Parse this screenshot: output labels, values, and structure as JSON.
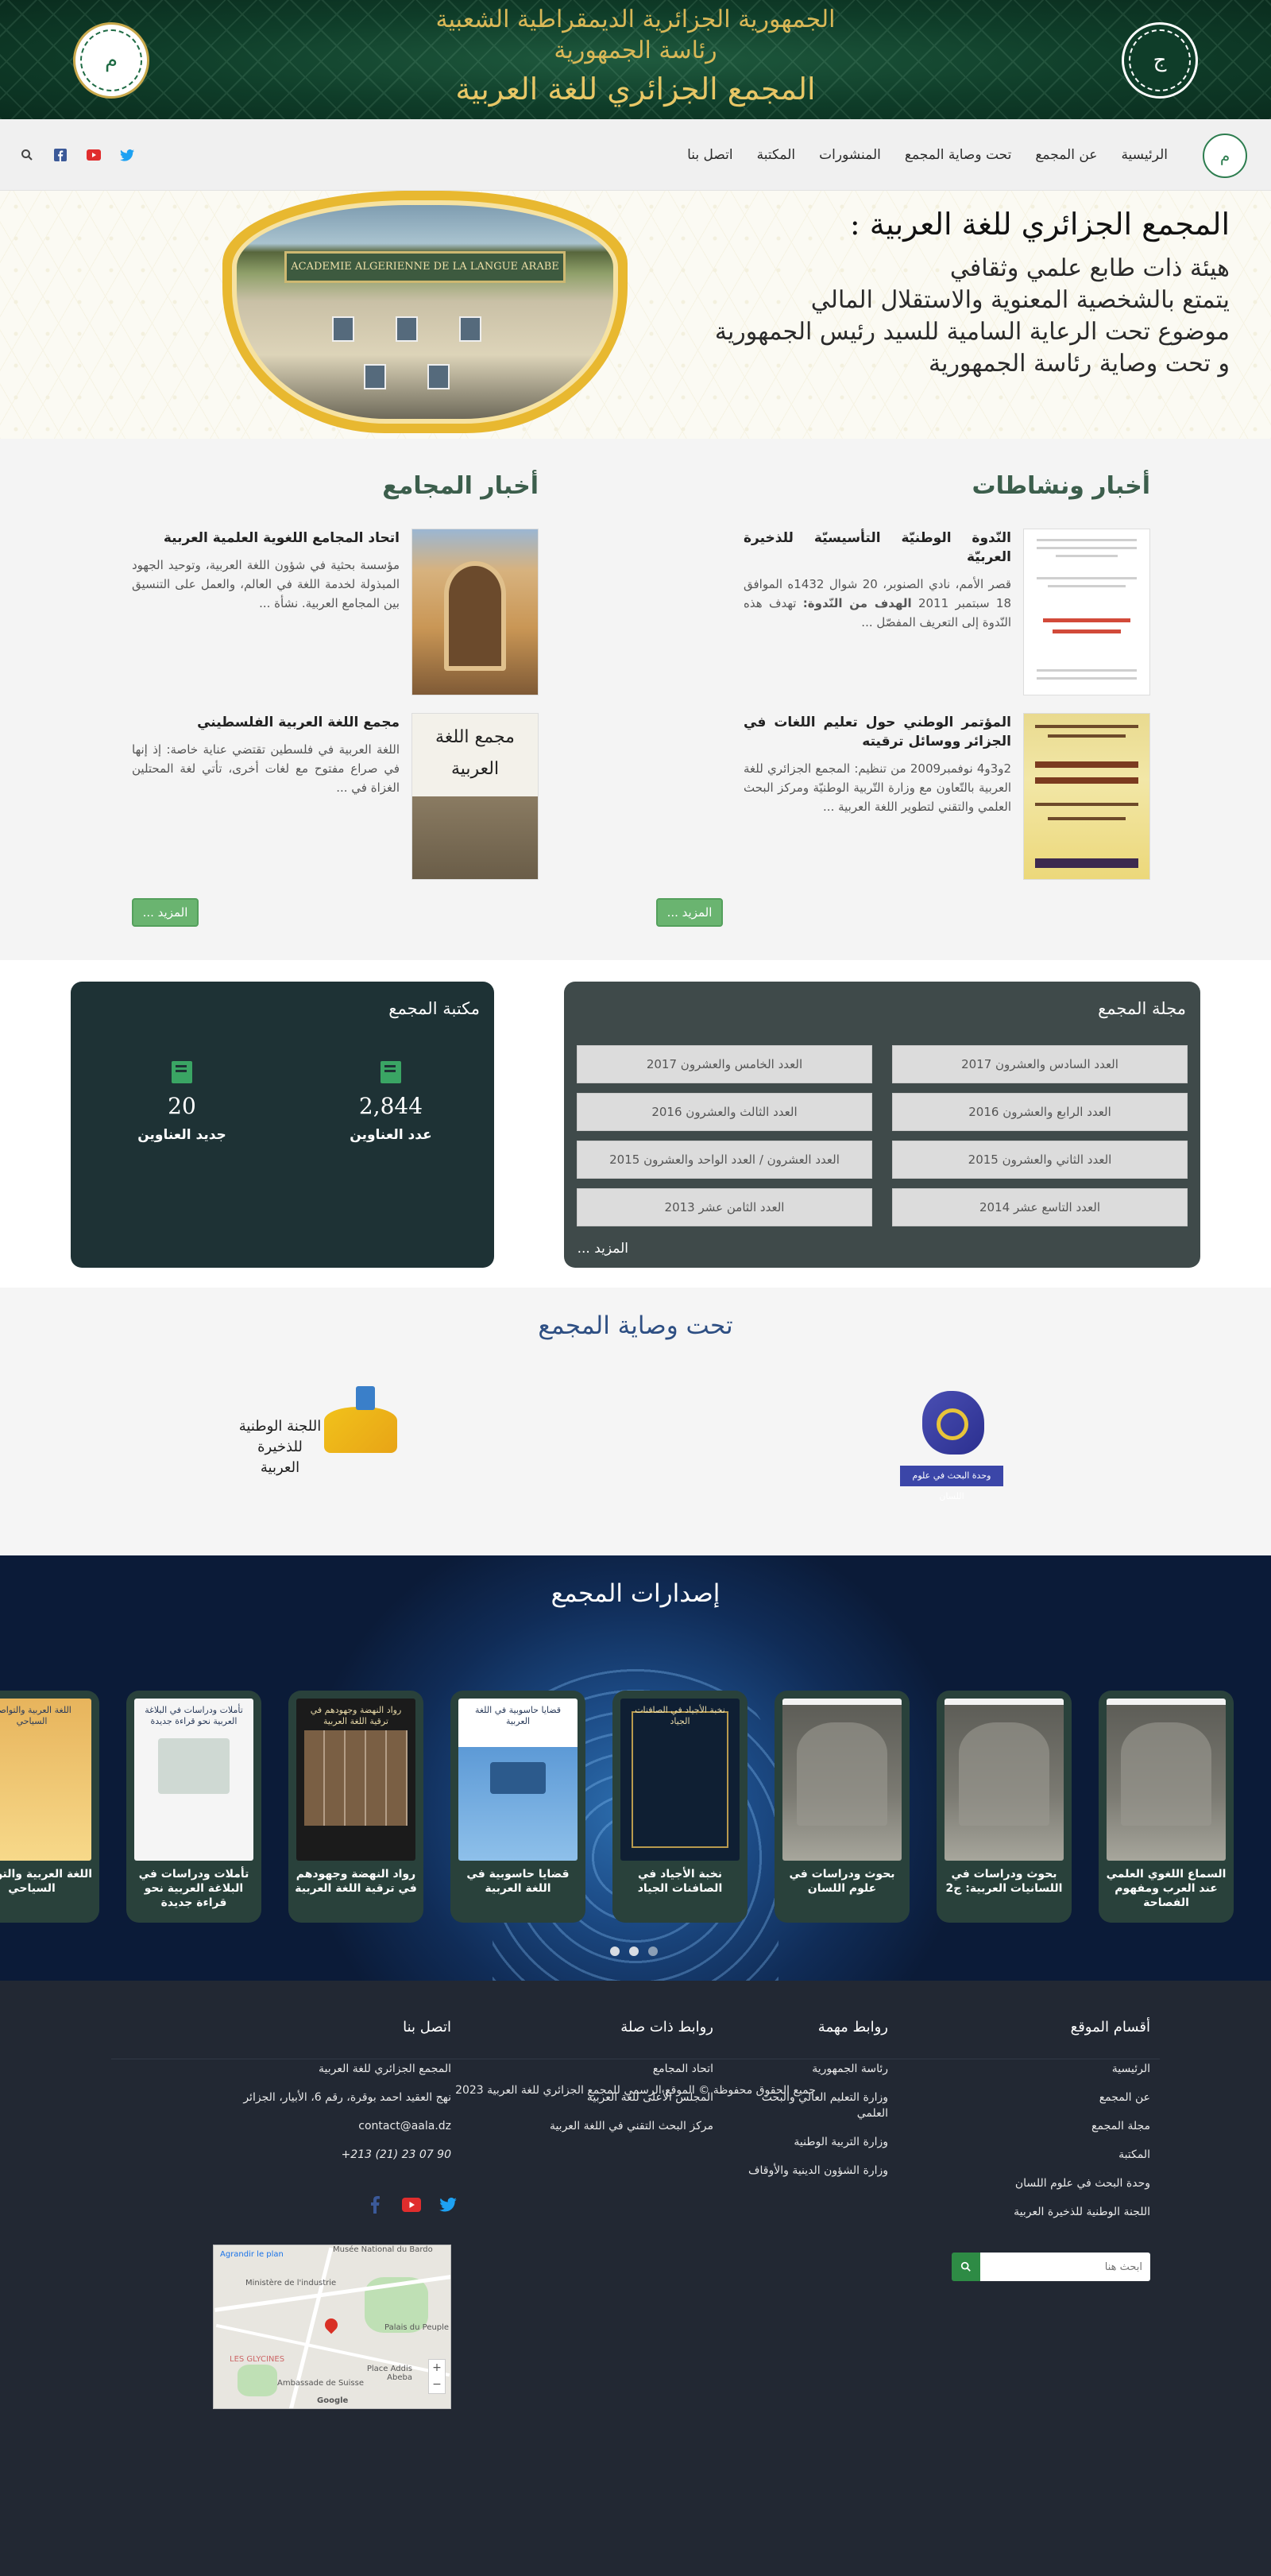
{
  "banner": {
    "line1": "الجمهورية الجزائرية الديمقراطية الشعبية",
    "line2": "رئاسة الجمهورية",
    "line3": "المجمع الجزائري للغة العربية"
  },
  "nav": {
    "items": [
      "الرئيسية",
      "عن المجمع",
      "تحت وصاية المجمع",
      "المنشورات",
      "المكتبة",
      "اتصل بنا"
    ]
  },
  "hero": {
    "title": "المجمع الجزائري للغة العربية :",
    "lines": [
      "هيئة ذات طابع علمي وثقافي",
      "يتمتع بالشخصية المعنوية والاستقلال المالي",
      "موضوع تحت الرعاية السامية للسيد رئيس الجمهورية",
      "و تحت وصاية رئاسة الجمهورية"
    ],
    "sign": "ACADEMIE ALGERIENNE DE LA LANGUE ARABE"
  },
  "news": {
    "activities_title": "أخبار ونشاطات",
    "academies_title": "أخبار المجامع",
    "activities": [
      {
        "title": "النّدوة الوطنيّة التأسيسيّة للذخيرة العربيّة",
        "text_plain": "قصر الأمم، نادي الصنوبر، 20 شوال 1432ه الموافق 18 سبتمبر 2011 ",
        "text_bold": "الهدف من النّدوة:",
        "text_rest": " تهدف هذه النّدوة إلى التعريف المفصّل ..."
      },
      {
        "title": "المؤتمر الوطني حول تعليم اللغات في الجزائر ووسائل ترقيته",
        "text_plain": "2و3و4 نوفمبر2009 من تنظيم: المجمع الجزائري للغة العربية بالتّعاون مع وزارة التّربية الوطنيّة ومركز البحث العلمي والتقني لتطوير اللغة العربية ..."
      }
    ],
    "academies": [
      {
        "title": "اتحاد المجامع اللغوية العلمية العربية",
        "text": "مؤسسة بحثية في شؤون اللغة العربية، وتوحيد الجهود المبذولة لخدمة اللغة في العالم، والعمل على التنسيق بين المجامع العربية. نشأة ..."
      },
      {
        "title": "مجمع اللغة العربية الفلسطيني",
        "text": " اللغة العربية في فلسطين تقتضي عناية خاصة: إذ إنها في صراع مفتوح مع لغات أخرى، تأتي لغة المحتلين الغزاة في ..."
      }
    ],
    "more_label": "المزيد ..."
  },
  "journal": {
    "title": "مجلة المجمع",
    "issues": [
      "العدد السادس والعشرون 2017",
      "العدد الخامس والعشرون 2017",
      "العدد الرابع والعشرون 2016",
      "العدد الثالث والعشرون 2016",
      "العدد الثاني والعشرون 2015",
      "العدد العشرون / العدد الواحد والعشرون 2015",
      "العدد التاسع عشر 2014",
      "العدد الثامن عشر 2013"
    ],
    "more_label": "المزيد ..."
  },
  "library": {
    "title": "مكتبة المجمع",
    "stats": [
      {
        "value": "2,844",
        "label": "عدد العناوين"
      },
      {
        "value": "20",
        "label": "جديد العناوين"
      }
    ]
  },
  "tutelage": {
    "title": "تحت وصاية المجمع",
    "logo_research": "وحدة البحث في علوم اللسان",
    "logo_committee": "اللجنة الوطنية للذخيرة العربية"
  },
  "publications": {
    "title": "إصدارات المجمع",
    "items": [
      {
        "title": "السماع اللغوي العلمي عند العرب ومفهوم الفصاحة",
        "cover": "stone"
      },
      {
        "title": "بحوث ودراسات في اللسانيات العربية: ج2",
        "cover": "stone"
      },
      {
        "title": "بحوث ودراسات في علوم اللسان",
        "cover": "stone"
      },
      {
        "title": "نخبة الأجياد في الصافنات الجياد",
        "cover": "dark",
        "cover_text": "نخبة الأجياد في الصافنات الجياد"
      },
      {
        "title": "قضايا حاسوبية في اللغة العربية",
        "cover": "blue",
        "cover_text": "قضايا حاسوبية في اللغة العربية"
      },
      {
        "title": "رواد النهضة وجهودهم في ترقية اللغة العربية",
        "cover": "faces",
        "cover_text": "رواد النهضة وجهودهم في ترقية اللغة العربية"
      },
      {
        "title": "تأملات ودراسات في البلاغة العربية نحو قراءة جديدة",
        "cover": "white",
        "cover_text": "تأملات ودراسات في البلاغة العربية نحو قراءة جديدة"
      },
      {
        "title": "اللغة العربية والتواصل السياحي",
        "cover": "yellow",
        "cover_text": "اللغة العربية والتواصل السياحي"
      }
    ]
  },
  "footer": {
    "sections": {
      "title": "أقسام الموقع",
      "items": [
        "الرئيسية",
        "عن المجمع",
        "مجلة المجمع",
        "المكتبة",
        "وحدة البحث في علوم اللسان",
        "اللجنة الوطنية للذخيرة العربية"
      ]
    },
    "important": {
      "title": "روابط مهمة",
      "items": [
        "رئاسة الجمهورية",
        "وزارة التعليم العالي والبحث العلمي",
        "وزارة التربية الوطنية",
        "وزارة الشؤون الدينية والأوقاف"
      ]
    },
    "related": {
      "title": "روابط ذات صلة",
      "items": [
        "اتحاد المجامع",
        "المجلس الأعلى للغة العربية",
        "مركز البحث التقني في اللغة العربية"
      ]
    },
    "contact": {
      "title": "اتصل بنا",
      "name": "المجمع الجزائري للغة العربية",
      "address": "نهج العقيد احمد بوقرة، رقم 6، الأبيار، الجزائر",
      "email": "contact@aala.dz",
      "phone": "+213 (21) 23 07 90"
    },
    "search_placeholder": "ابحث هنا",
    "map": {
      "labels": [
        "Musée National du Bardo",
        "Ministère de l'industrie",
        "Palais du Peuple",
        "LES GLYCINES",
        "Place Addis Abeba",
        "Ambassade de Suisse",
        "Agrandir le plan",
        "Google"
      ]
    },
    "copyright": "جميع الحقوق محفوظة © الموقع الرسمي للمجمع الجزائري للغة العربية 2023"
  },
  "colors": {
    "banner_green": "#0f3d29",
    "gold": "#d9b857",
    "btn_green": "#6ab470",
    "journal_bg": "#3f4a4a",
    "library_bg": "#1e3235",
    "footer_bg": "#222833",
    "title_blue": "#2e4f83"
  }
}
